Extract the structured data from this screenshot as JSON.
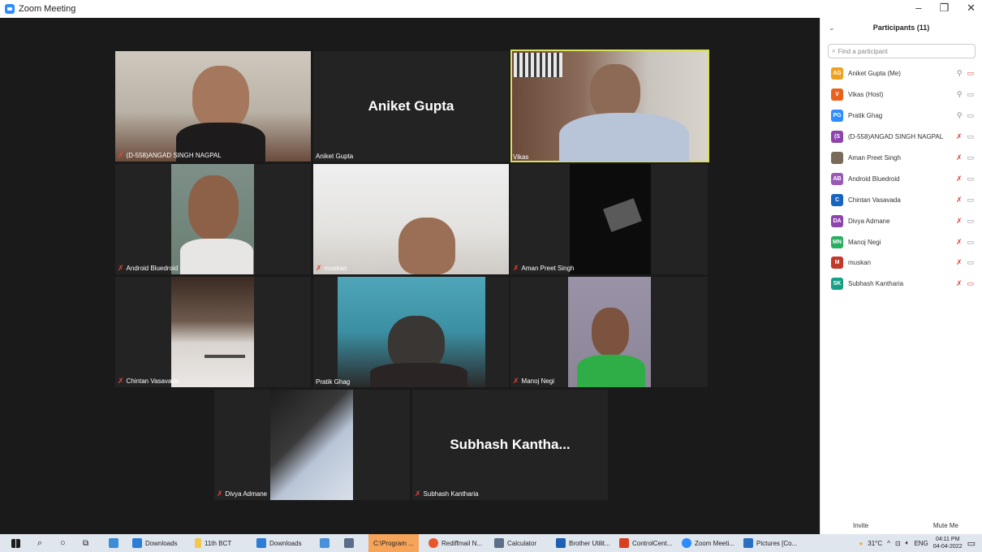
{
  "window": {
    "title": "Zoom Meeting",
    "minimize": "–",
    "restore": "❐",
    "close": "✕"
  },
  "tiles": {
    "angad": {
      "name": "(D-558)ANGAD SINGH NAGPAL"
    },
    "aniket": {
      "name": "Aniket Gupta",
      "big": "Aniket Gupta"
    },
    "vikas": {
      "name": "Vikas"
    },
    "android": {
      "name": "Android Bluedroid"
    },
    "muskan": {
      "name": "muskan"
    },
    "aman": {
      "name": "Aman Preet Singh"
    },
    "chintan": {
      "name": "Chintan Vasavada"
    },
    "pratik": {
      "name": "Pratik Ghag"
    },
    "manoj": {
      "name": "Manoj Negi"
    },
    "divya": {
      "name": "Divya Admane"
    },
    "subhash": {
      "name": "Subhash Kantharia",
      "big": "Subhash  Kantha..."
    }
  },
  "panel": {
    "title": "Participants (11)",
    "search_placeholder": "Find a participant",
    "participants": [
      {
        "initials": "AG",
        "color": "#f0a020",
        "name": "Aniket Gupta (Me)",
        "mic": "on",
        "cam": "off"
      },
      {
        "initials": "V",
        "color": "#e8621b",
        "name": "Vikas (Host)",
        "mic": "on",
        "cam": "on"
      },
      {
        "initials": "PG",
        "color": "#2d8cff",
        "name": "Pratik Ghag",
        "mic": "on",
        "cam": "on"
      },
      {
        "initials": "(S",
        "color": "#8e44ad",
        "name": "(D-558)ANGAD SINGH NAGPAL",
        "mic": "off",
        "cam": "on"
      },
      {
        "initials": "",
        "color": "#7a6a5a",
        "name": "Aman Preet Singh",
        "mic": "off",
        "cam": "on"
      },
      {
        "initials": "AB",
        "color": "#9b59b6",
        "name": "Android Bluedroid",
        "mic": "off",
        "cam": "on"
      },
      {
        "initials": "C",
        "color": "#1565c0",
        "name": "Chintan Vasavada",
        "mic": "off",
        "cam": "on"
      },
      {
        "initials": "DA",
        "color": "#8e44ad",
        "name": "Divya Admane",
        "mic": "off",
        "cam": "on"
      },
      {
        "initials": "MN",
        "color": "#27ae60",
        "name": "Manoj Negi",
        "mic": "off",
        "cam": "on"
      },
      {
        "initials": "M",
        "color": "#c0392b",
        "name": "muskan",
        "mic": "off",
        "cam": "on"
      },
      {
        "initials": "SK",
        "color": "#16a085",
        "name": "Subhash Kantharia",
        "mic": "off",
        "cam": "off"
      }
    ],
    "invite_label": "Invite",
    "mute_label": "Mute Me"
  },
  "taskbar": {
    "items": [
      "Downloads",
      "11th BCT",
      "Downloads",
      "C:\\Program ...",
      "Rediffmail N...",
      "Calculator",
      "Brother Utilit...",
      "ControlCent...",
      "Zoom Meeti...",
      "Pictures [Co..."
    ],
    "temp": "31°C",
    "lang": "ENG",
    "time": "04:11 PM",
    "date": "04-04-2022"
  }
}
